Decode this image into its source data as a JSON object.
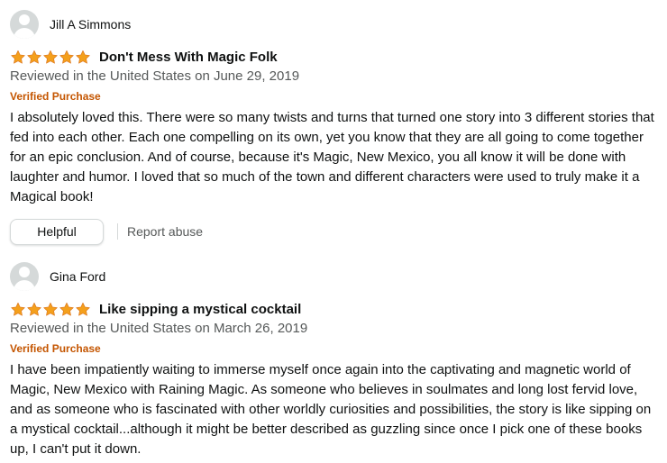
{
  "colors": {
    "star": "#f4a01c",
    "verified": "#c45500",
    "secondary_text": "#565959",
    "primary_text": "#0f1111"
  },
  "reviews": [
    {
      "author": "Jill A Simmons",
      "rating": 5,
      "rating_max": 5,
      "title": "Don't Mess With Magic Folk",
      "date_line": "Reviewed in the United States on June 29, 2019",
      "badge": "Verified Purchase",
      "body": "I absolutely loved this. There were so many twists and turns that turned one story into 3 different stories that fed into each other. Each one compelling on its own, yet you know that they are all going to come together for an epic conclusion. And of course, because it's Magic, New Mexico, you all know it will be done with laughter and humor. I loved that so much of the town and different characters were used to truly make it a Magical book!",
      "helpful_label": "Helpful",
      "report_label": "Report abuse"
    },
    {
      "author": "Gina Ford",
      "rating": 5,
      "rating_max": 5,
      "title": "Like sipping a mystical cocktail",
      "date_line": "Reviewed in the United States on March 26, 2019",
      "badge": "Verified Purchase",
      "body": "I have been impatiently waiting to immerse myself once again into the captivating and magnetic world of Magic, New Mexico with Raining Magic. As someone who believes in soulmates and long lost fervid love, and as someone who is fascinated with other worldly curiosities and possibilities, the story is like sipping on a mystical cocktail...although it might be better described as guzzling since once I pick one of these books up, I can't put it down."
    }
  ],
  "icons": {
    "avatar": "user-avatar-icon",
    "star": "star-filled-icon"
  }
}
